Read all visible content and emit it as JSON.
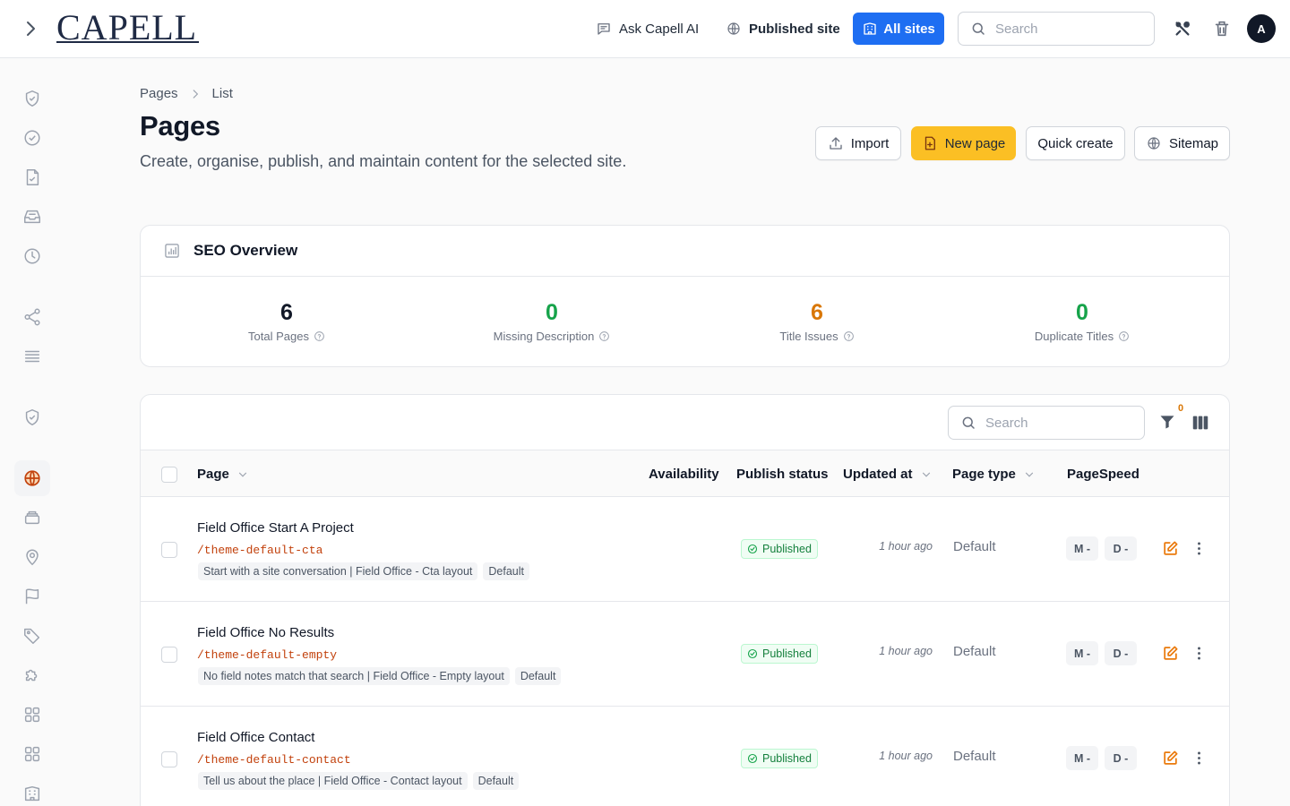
{
  "app": {
    "logo_text": "CAPELL"
  },
  "topbar": {
    "ask_ai": "Ask Capell AI",
    "published_site": "Published site",
    "all_sites": "All sites",
    "search_placeholder": "Search",
    "avatar_initial": "A"
  },
  "breadcrumb": {
    "root": "Pages",
    "current": "List"
  },
  "header": {
    "title": "Pages",
    "subtitle": "Create, organise, publish, and maintain content for the selected site.",
    "import_label": "Import",
    "new_page_label": "New page",
    "quick_create_label": "Quick create",
    "sitemap_label": "Sitemap"
  },
  "seo": {
    "title": "SEO Overview",
    "stats": [
      {
        "value": "6",
        "label": "Total Pages",
        "color": "#111827"
      },
      {
        "value": "0",
        "label": "Missing Description",
        "color": "#16a34a"
      },
      {
        "value": "6",
        "label": "Title Issues",
        "color": "#d97706"
      },
      {
        "value": "0",
        "label": "Duplicate Titles",
        "color": "#16a34a"
      }
    ]
  },
  "table": {
    "search_placeholder": "Search",
    "filter_count": "0",
    "columns": {
      "page": "Page",
      "availability": "Availability",
      "publish_status": "Publish status",
      "updated_at": "Updated at",
      "page_type": "Page type",
      "pagespeed": "PageSpeed"
    },
    "rows": [
      {
        "title": "Field Office Start A Project",
        "slug": "/theme-default-cta",
        "tag_desc": "Start with a site conversation | Field Office - Cta layout",
        "tag_type": "Default",
        "status": "Published",
        "updated": "1 hour ago",
        "page_type": "Default",
        "ps_mobile": "M -",
        "ps_desktop": "D -"
      },
      {
        "title": "Field Office No Results",
        "slug": "/theme-default-empty",
        "tag_desc": "No field notes match that search | Field Office - Empty layout",
        "tag_type": "Default",
        "status": "Published",
        "updated": "1 hour ago",
        "page_type": "Default",
        "ps_mobile": "M -",
        "ps_desktop": "D -"
      },
      {
        "title": "Field Office Contact",
        "slug": "/theme-default-contact",
        "tag_desc": "Tell us about the place | Field Office - Contact layout",
        "tag_type": "Default",
        "status": "Published",
        "updated": "1 hour ago",
        "page_type": "Default",
        "ps_mobile": "M -",
        "ps_desktop": "D -"
      }
    ]
  },
  "sidebar": {
    "items": [
      "shield-check-icon",
      "check-circle-icon",
      "file-check-icon",
      "inbox-icon",
      "clock-icon",
      "share-icon",
      "list-icon",
      "shield-check-icon",
      "globe-icon",
      "layers-icon",
      "map-pin-icon",
      "flag-icon",
      "tag-icon",
      "puzzle-icon",
      "grid-icon",
      "grid-icon",
      "building-icon"
    ],
    "active": "globe-icon"
  }
}
